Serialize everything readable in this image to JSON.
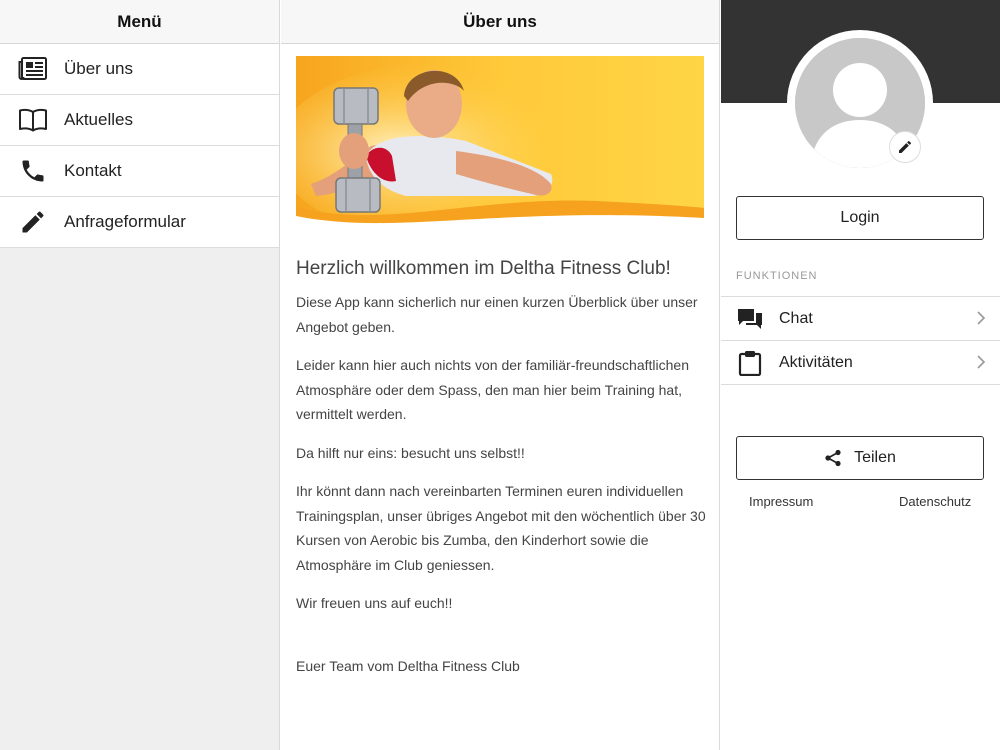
{
  "menu": {
    "title": "Menü",
    "items": [
      {
        "label": "Über uns",
        "icon": "newspaper-icon"
      },
      {
        "label": "Aktuelles",
        "icon": "book-icon"
      },
      {
        "label": "Kontakt",
        "icon": "phone-icon"
      },
      {
        "label": "Anfrageformular",
        "icon": "pencil-icon"
      }
    ]
  },
  "content": {
    "title": "Über uns",
    "banner_image": "fitness-woman-dumbbell-image",
    "heading": "Herzlich willkommen im Deltha Fitness Club!",
    "paragraphs": [
      "Diese App kann sicherlich nur einen kurzen Überblick über unser Angebot geben.",
      "Leider kann hier auch nichts von der familiär-freundschaftlichen Atmosphäre oder dem Spass, den man hier beim Training hat, vermittelt werden.",
      "Da hilft nur eins: besucht uns selbst!!",
      "Ihr könnt dann nach vereinbarten Terminen euren individuellen Trainingsplan, unser übriges Angebot mit den wöchentlich über 30 Kursen von Aerobic bis Zumba, den Kinderhort sowie die Atmosphäre im Club geniessen.",
      "Wir freuen uns auf euch!!"
    ],
    "signature": "Euer Team vom Deltha Fitness Club"
  },
  "side": {
    "login_label": "Login",
    "section_title": "FUNKTIONEN",
    "functions": [
      {
        "label": "Chat",
        "icon": "chat-icon"
      },
      {
        "label": "Aktivitäten",
        "icon": "clipboard-icon"
      }
    ],
    "share_label": "Teilen",
    "impressum": "Impressum",
    "datenschutz": "Datenschutz"
  },
  "colors": {
    "header_dark": "#333333",
    "banner_orange": "#f9a31b",
    "banner_yellow": "#ffcd3a"
  }
}
